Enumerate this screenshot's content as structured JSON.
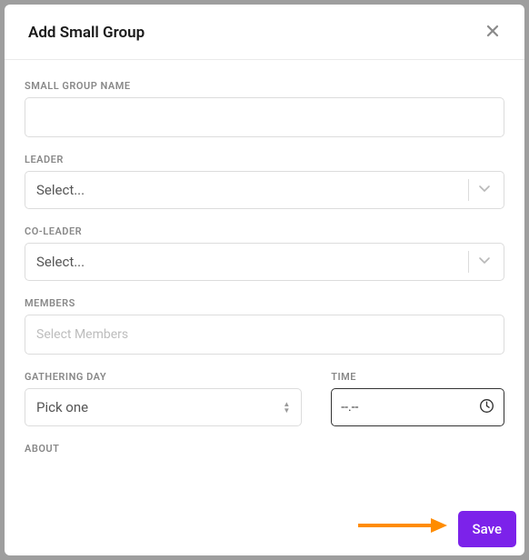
{
  "modal": {
    "title": "Add Small Group",
    "fields": {
      "name": {
        "label": "SMALL GROUP NAME",
        "value": ""
      },
      "leader": {
        "label": "LEADER",
        "placeholder": "Select..."
      },
      "coleader": {
        "label": "CO-LEADER",
        "placeholder": "Select..."
      },
      "members": {
        "label": "MEMBERS",
        "placeholder": "Select Members"
      },
      "day": {
        "label": "GATHERING DAY",
        "placeholder": "Pick one"
      },
      "time": {
        "label": "TIME",
        "placeholder": "--.--"
      },
      "about": {
        "label": "ABOUT"
      }
    },
    "buttons": {
      "save": "Save"
    }
  }
}
